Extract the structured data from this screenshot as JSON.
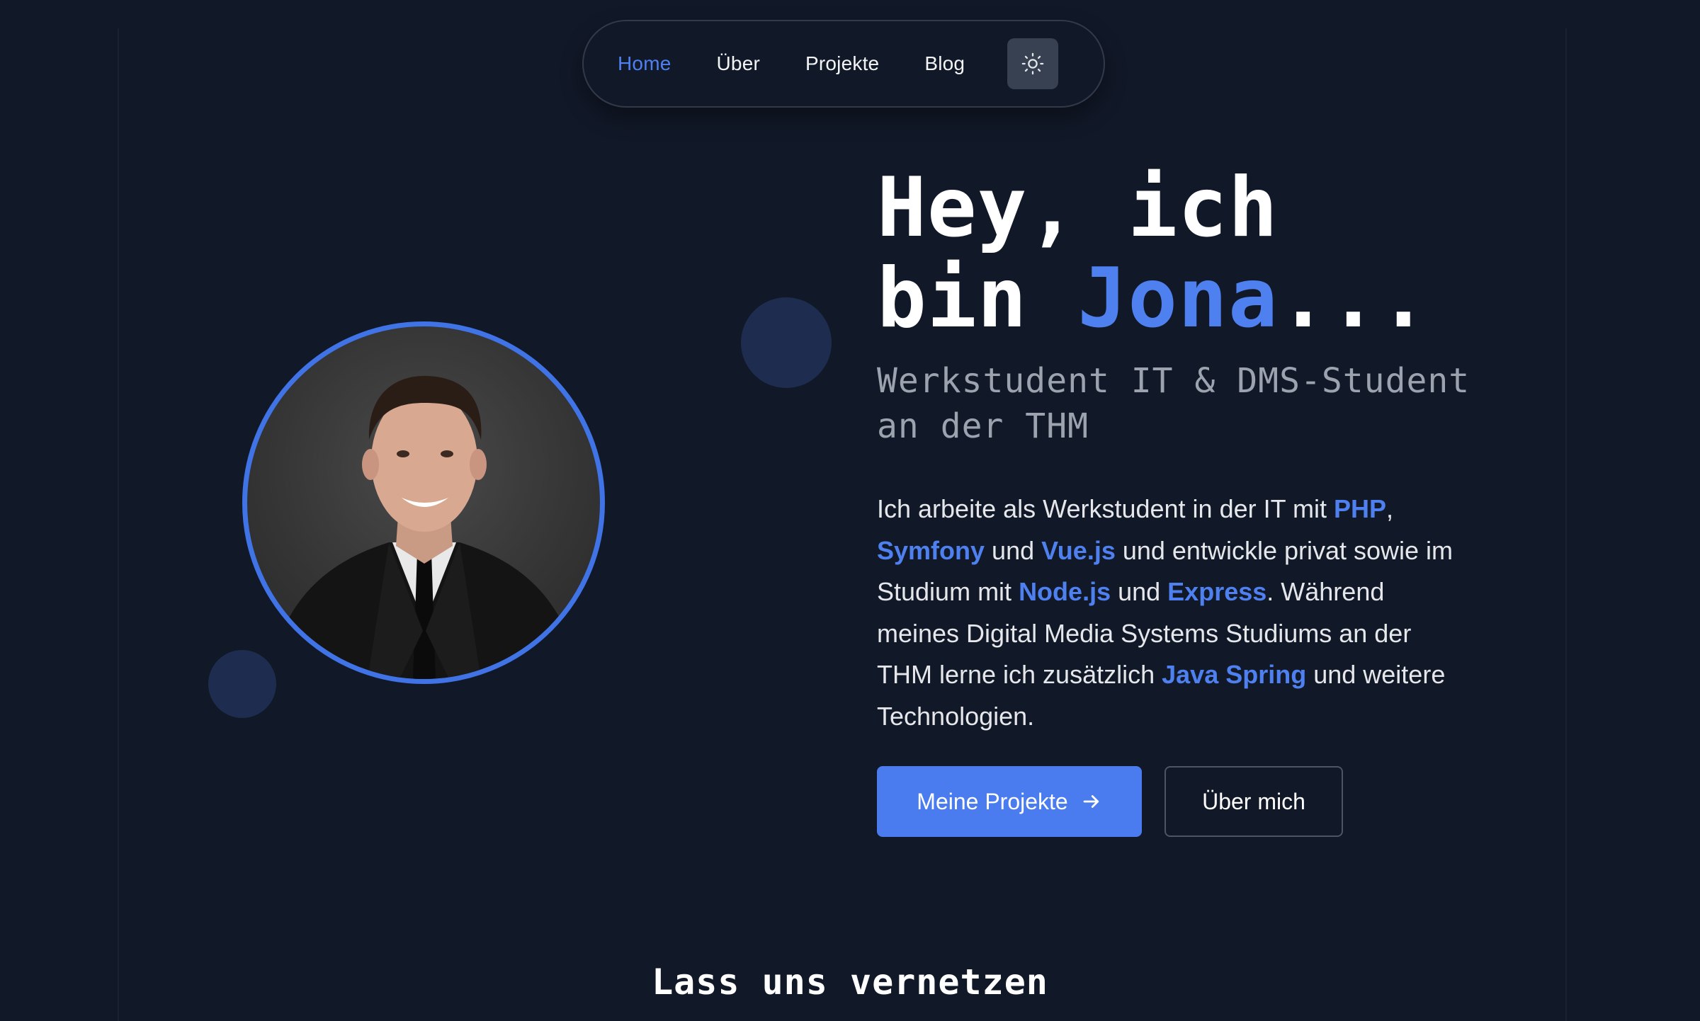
{
  "nav": {
    "items": [
      {
        "label": "Home",
        "active": true
      },
      {
        "label": "Über",
        "active": false
      },
      {
        "label": "Projekte",
        "active": false
      },
      {
        "label": "Blog",
        "active": false
      }
    ],
    "theme_toggle_icon": "sun-icon"
  },
  "hero": {
    "title_line1": "Hey, ich",
    "title_prefix": "bin ",
    "title_name": "Jona",
    "title_suffix": "...",
    "subtitle": "Werkstudent IT & DMS-Student an der THM",
    "description": {
      "p1": "Ich arbeite als Werkstudent in der IT mit ",
      "t1": "PHP",
      "p2": ", ",
      "t2": "Symfony",
      "p3": " und ",
      "t3": "Vue.js",
      "p4": " und entwickle privat sowie im Studium mit ",
      "t4": "Node.js",
      "p5": " und ",
      "t5": "Express",
      "p6": ". Während meines Digital Media Systems Studiums an der THM lerne ich zusätzlich ",
      "t6": "Java Spring",
      "p7": " und weitere Technologien."
    },
    "primary_button": {
      "label": "Meine Projekte",
      "icon": "arrow-right-icon"
    },
    "secondary_button": {
      "label": "Über mich"
    }
  },
  "connect": {
    "heading": "Lass uns vernetzen"
  },
  "colors": {
    "background": "#111827",
    "accent": "#4f80f0",
    "muted_text": "#9ca3af",
    "blob": "#1e2d4f"
  }
}
